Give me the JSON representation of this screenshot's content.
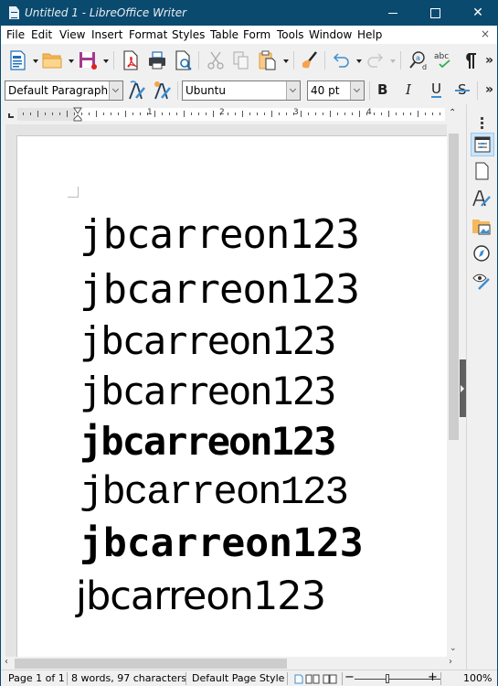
{
  "window": {
    "title": "Untitled 1 - LibreOffice Writer"
  },
  "menubar": {
    "items": [
      "File",
      "Edit",
      "View",
      "Insert",
      "Format",
      "Styles",
      "Table",
      "Form",
      "Tools",
      "Window",
      "Help"
    ],
    "close_label": "×"
  },
  "toolbar": {
    "standard": [
      "new-document",
      "open",
      "save",
      "export-pdf",
      "print",
      "print-preview",
      "cut",
      "copy",
      "paste",
      "clone-formatting",
      "undo",
      "redo",
      "find-replace",
      "spelling",
      "formatting-marks"
    ],
    "more_label": "»"
  },
  "formatting": {
    "paragraph_style": "Default Paragraph Style",
    "font_name": "Ubuntu",
    "font_size": "40 pt",
    "bold_label": "B",
    "italic_label": "I",
    "underline_label": "U",
    "strike_label": "S",
    "more_label": "»"
  },
  "ruler": {
    "numbers": [
      "1",
      "2",
      "3",
      "4"
    ]
  },
  "document": {
    "lines": [
      {
        "text": "jbcarreon123",
        "style": "mono-light"
      },
      {
        "text": "jbcarreon123",
        "style": "mono-regular"
      },
      {
        "text": "jbcarreon123",
        "style": "mono-medium"
      },
      {
        "text": "jbcarreon123",
        "style": "mono-book"
      },
      {
        "text": "jbcarreon123",
        "style": "mono-bold"
      },
      {
        "text": "jbcarreon123",
        "style": "mono-thin"
      },
      {
        "text": "jbcarreon123",
        "style": "mono-extrabold"
      },
      {
        "text": "jbcarreon123",
        "style": "sans-regular"
      }
    ]
  },
  "sidebar": {
    "buttons": [
      "properties",
      "page",
      "styles",
      "gallery",
      "navigator",
      "manage-changes"
    ],
    "active": "properties"
  },
  "statusbar": {
    "page": "Page 1 of 1",
    "word_count": "8 words, 97 characters",
    "page_style": "Default Page Style",
    "zoom_minus": "−",
    "zoom_plus": "+",
    "zoom_level": "100%"
  }
}
